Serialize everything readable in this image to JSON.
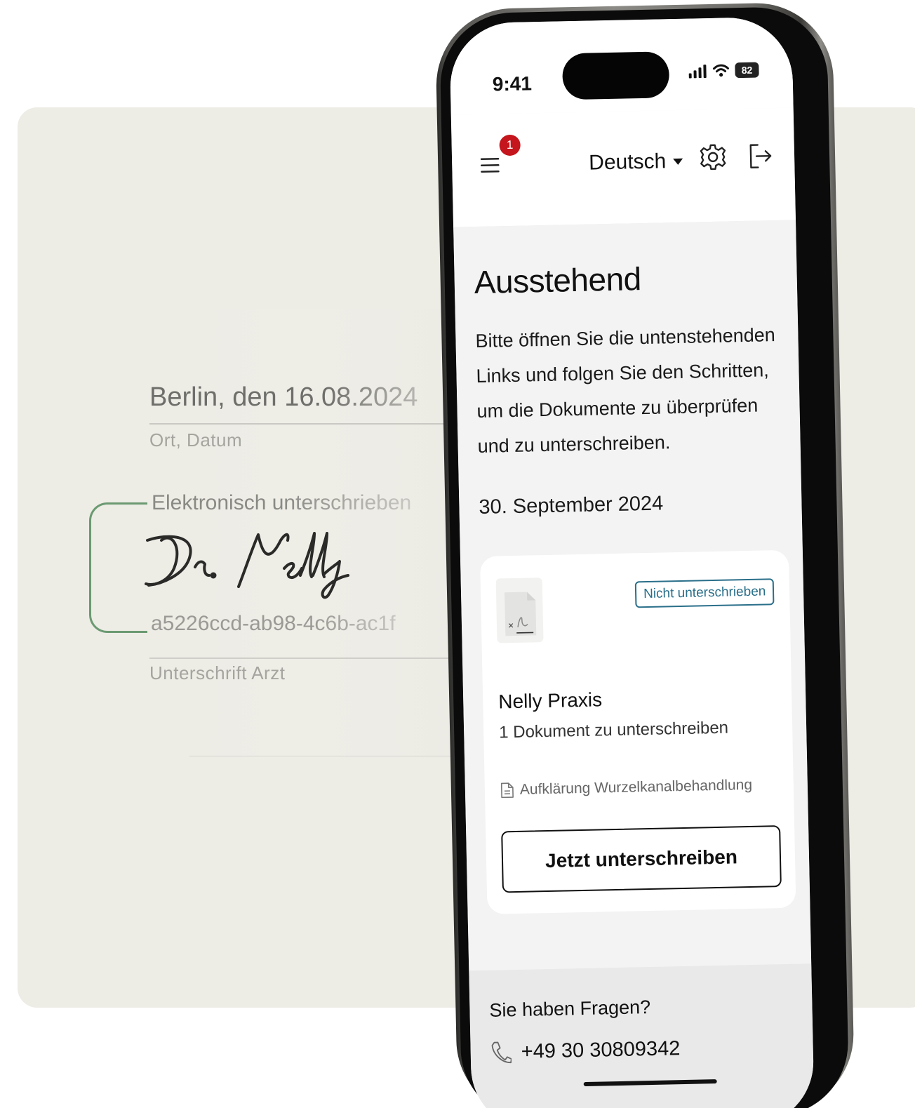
{
  "background": {
    "card_color": "#edece5",
    "accent_green": "#6b9a72"
  },
  "signature_panel": {
    "place_date_value": "Berlin, den 16.08.2024",
    "place_date_label": "Ort, Datum",
    "electronic_label": "Elektronisch unterschrieben",
    "signature_name": "Dr. Nelly",
    "signature_hash": "a5226ccd-ab98-4c6b-ac1f",
    "doctor_signature_label": "Unterschrift Arzt"
  },
  "status_bar": {
    "time": "9:41",
    "battery": "82",
    "icons": [
      "signal-icon",
      "wifi-icon",
      "battery-icon"
    ]
  },
  "header": {
    "menu_icon": "hamburger-menu-icon",
    "notification_count": "1",
    "language": "Deutsch",
    "settings_icon": "gear-icon",
    "logout_icon": "logout-icon"
  },
  "content": {
    "title": "Ausstehend",
    "description": "Bitte öffnen Sie die untenstehenden Links und folgen Sie den Schritten, um die Dokumente zu überprüfen und zu unterschreiben.",
    "date_heading": "30. September 2024",
    "card": {
      "thumbnail_icon": "signature-document-icon",
      "status": "Nicht unterschrieben",
      "status_color": "#2a6f8a",
      "practice": "Nelly Praxis",
      "document_count": "1 Dokument zu unterschreiben",
      "file_icon": "document-icon",
      "file_name": "Aufklärung Wurzelkanalbehandlung",
      "action_label": "Jetzt unterschreiben"
    }
  },
  "footer": {
    "title": "Sie haben Fragen?",
    "phone_icon": "phone-icon",
    "phone_number": "+49 30 30809342"
  },
  "colors": {
    "badge": "#c4161c",
    "screen_bg": "#f3f3f3",
    "footer_bg": "#e9e9e9"
  }
}
